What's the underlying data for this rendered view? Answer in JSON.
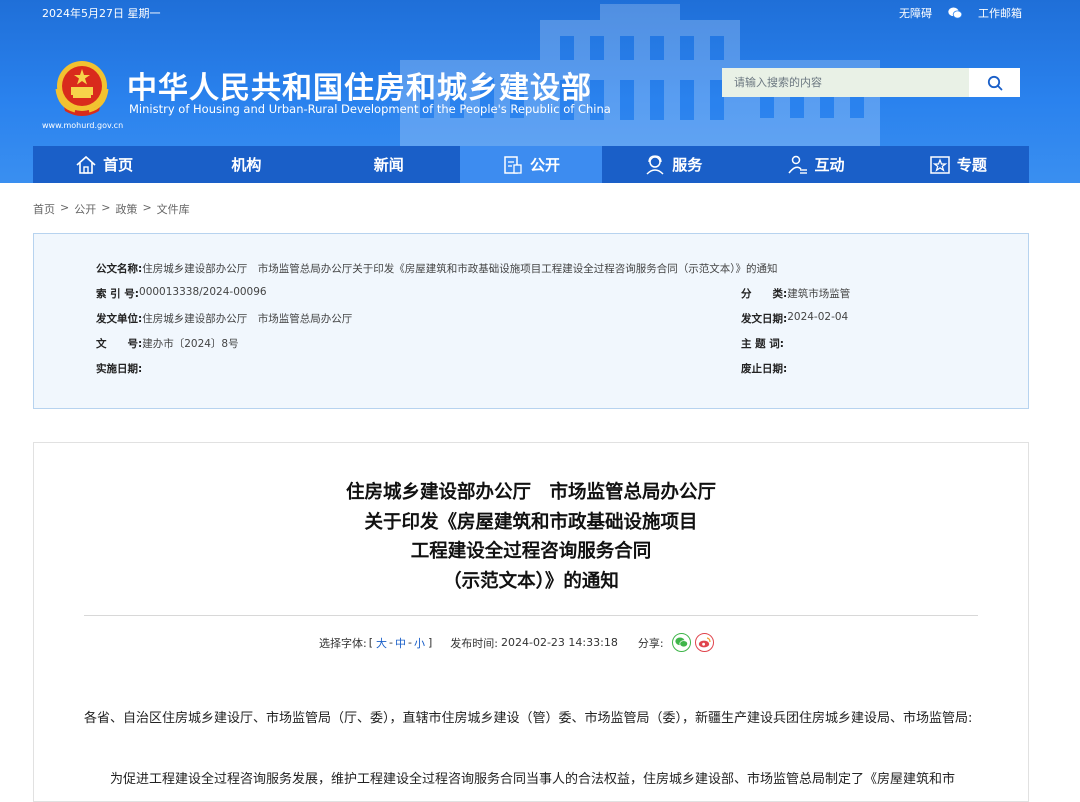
{
  "topbar": {
    "date": "2024年5月27日 星期一",
    "accessibility": "无障碍",
    "work_mailbox": "工作邮箱"
  },
  "site": {
    "title": "中华人民共和国住房和城乡建设部",
    "subtitle": "Ministry of Housing and Urban-Rural Development of the People's Republic of China",
    "url": "www.mohurd.gov.cn"
  },
  "search": {
    "placeholder": "请输入搜索的内容"
  },
  "nav": {
    "items": [
      {
        "label": "首页",
        "icon": "home-icon"
      },
      {
        "label": "机构",
        "icon": ""
      },
      {
        "label": "新闻",
        "icon": ""
      },
      {
        "label": "公开",
        "icon": "document-icon",
        "active": true
      },
      {
        "label": "服务",
        "icon": "service-icon"
      },
      {
        "label": "互动",
        "icon": "interaction-icon"
      },
      {
        "label": "专题",
        "icon": "star-icon"
      }
    ]
  },
  "breadcrumb": [
    "首页",
    "公开",
    "政策",
    "文件库"
  ],
  "breadcrumb_sep": ">",
  "meta": {
    "doc_name_label": "公文名称:",
    "doc_name": "住房城乡建设部办公厅　市场监管总局办公厅关于印发《房屋建筑和市政基础设施项目工程建设全过程咨询服务合同（示范文本）》的通知",
    "index_label": "索 引 号:",
    "index": "000013338/2024-00096",
    "category_label": "分　　类:",
    "category": "建筑市场监管",
    "issuer_label": "发文单位:",
    "issuer": "住房城乡建设部办公厅　市场监管总局办公厅",
    "issue_date_label": "发文日期:",
    "issue_date": "2024-02-04",
    "doc_no_label": "文　　号:",
    "doc_no": "建办市〔2024〕8号",
    "subject_label": "主 题 词:",
    "subject": "",
    "effective_label": "实施日期:",
    "effective": "",
    "repeal_label": "废止日期:",
    "repeal": ""
  },
  "article": {
    "title_lines": [
      "住房城乡建设部办公厅　市场监管总局办公厅",
      "关于印发《房屋建筑和市政基础设施项目",
      "工程建设全过程咨询服务合同",
      "（示范文本）》的通知"
    ],
    "font_size_label": "选择字体:",
    "font_open": "[",
    "font_large": "大",
    "font_medium": "中",
    "font_small": "小",
    "font_sep": "-",
    "font_close": "]",
    "publish_label": "发布时间:",
    "publish_time": "2024-02-23 14:33:18",
    "share_label": "分享:",
    "para1": "各省、自治区住房城乡建设厅、市场监管局（厅、委），直辖市住房城乡建设（管）委、市场监管局（委），新疆生产建设兵团住房城乡建设局、市场监管局:",
    "para2": "为促进工程建设全过程咨询服务发展，维护工程建设全过程咨询服务合同当事人的合法权益，住房城乡建设部、市场监管总局制定了《房屋建筑和市"
  },
  "colors": {
    "header": "#2a82ee",
    "nav": "#1a5fc8",
    "nav_active": "#3d8cf0",
    "meta_bg": "#f1f7fd"
  }
}
